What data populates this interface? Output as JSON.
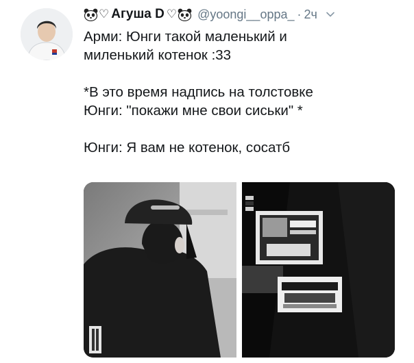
{
  "tweet": {
    "display_name": "Агуша D",
    "handle": "@yoongi__oppa_",
    "separator": "·",
    "time": "2ч",
    "lines": [
      "Арми: Юнги такой маленький и",
      "миленький котенок :33",
      "",
      "*В это время надпись на толстовке",
      "Юнги: \"покажи мне свои сиськи\" *",
      "",
      "Юнги: Я вам не котенок, сосатб"
    ]
  },
  "icons": {
    "avatar": "avatar",
    "panda_left": "panda-emoji-icon",
    "heart_left": "white-heart-icon",
    "heart_right": "white-heart-icon",
    "panda_right": "panda-emoji-icon",
    "caret": "chevron-down-icon"
  },
  "media": {
    "images": [
      "photo-back-of-person-in-cap-and-hoodie",
      "photo-hoodie-back-print-closeup"
    ]
  }
}
